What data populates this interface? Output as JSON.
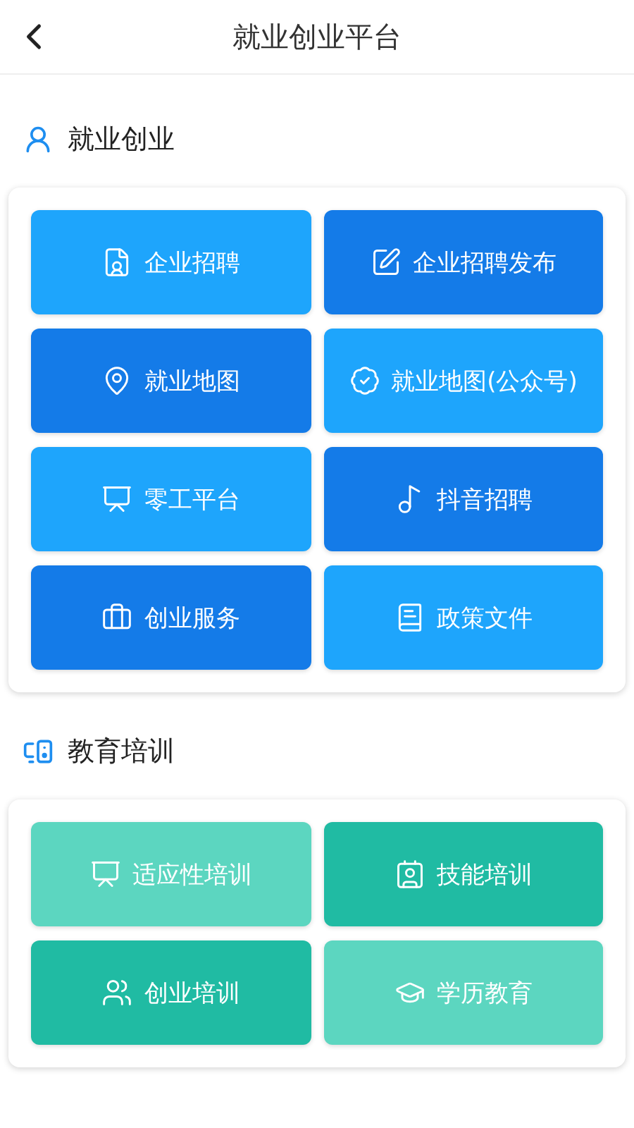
{
  "header": {
    "title": "就业创业平台"
  },
  "sections": [
    {
      "title": "就业创业",
      "items": [
        {
          "label": "企业招聘",
          "color": "#1ea5fc"
        },
        {
          "label": "企业招聘发布",
          "color": "#147be8"
        },
        {
          "label": "就业地图",
          "color": "#147be8"
        },
        {
          "label": "就业地图(公众号)",
          "color": "#1ea5fc"
        },
        {
          "label": "零工平台",
          "color": "#1ea5fc"
        },
        {
          "label": "抖音招聘",
          "color": "#147be8"
        },
        {
          "label": "创业服务",
          "color": "#147be8"
        },
        {
          "label": "政策文件",
          "color": "#1ea5fc"
        }
      ]
    },
    {
      "title": "教育培训",
      "items": [
        {
          "label": "适应性培训",
          "color": "#5cd6c0"
        },
        {
          "label": "技能培训",
          "color": "#20bba3"
        },
        {
          "label": "创业培训",
          "color": "#20bba3"
        },
        {
          "label": "学历教育",
          "color": "#5cd6c0"
        }
      ]
    }
  ]
}
